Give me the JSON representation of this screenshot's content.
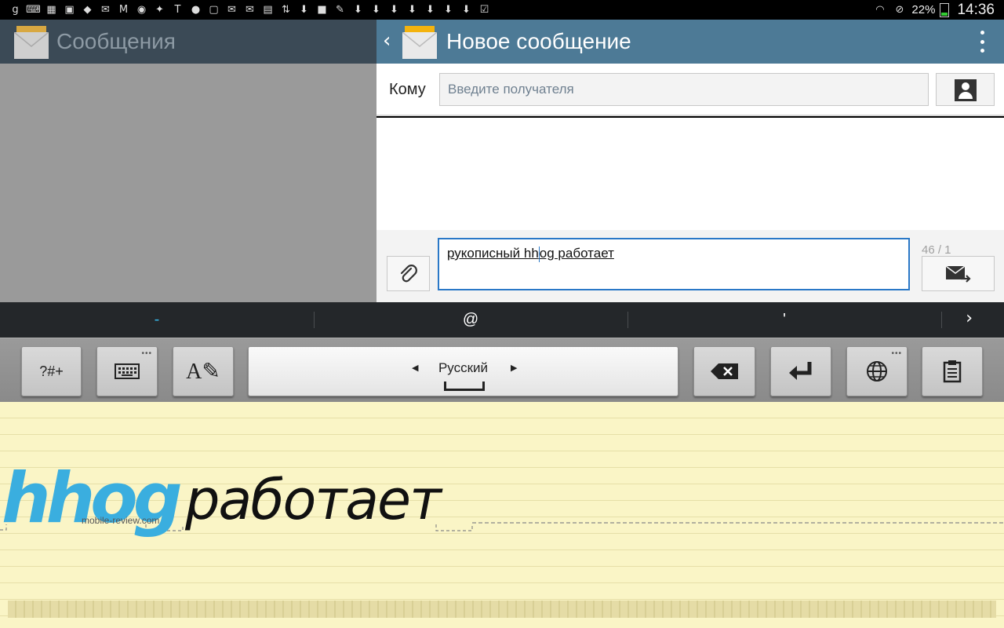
{
  "status_bar": {
    "battery_percent": "22%",
    "time": "14:36",
    "left_icons": [
      "google-plus",
      "keyboard",
      "calendar",
      "image",
      "dropbox",
      "mail",
      "gmail",
      "chrome",
      "twitter",
      "nyt",
      "chat",
      "window",
      "mail",
      "mail",
      "shop",
      "sync",
      "download",
      "store",
      "pin",
      "download",
      "download",
      "download",
      "download",
      "download",
      "download",
      "download",
      "checklist"
    ]
  },
  "left_pane": {
    "title": "Сообщения"
  },
  "right_pane": {
    "title": "Новое сообщение",
    "to_label": "Кому",
    "to_placeholder": "Введите получателя",
    "message_text": "рукописный hhog работает",
    "message_before_cursor": "рукописный hh",
    "message_after_cursor": "og работает",
    "char_counter": "46 / 1"
  },
  "suggestions": [
    "-",
    "@",
    "'"
  ],
  "keyboard": {
    "symbols_label": "?#+",
    "language": "Русский"
  },
  "handwriting": {
    "recognized_word": "hhog",
    "word2": "работает",
    "watermark": "mobile-review.com"
  },
  "colors": {
    "header_left": "#3b4a56",
    "header_right": "#4d7a96",
    "accent": "#2a78c7",
    "suggestion_highlight": "#37b6e6",
    "pad_bg": "#faf5c6"
  }
}
